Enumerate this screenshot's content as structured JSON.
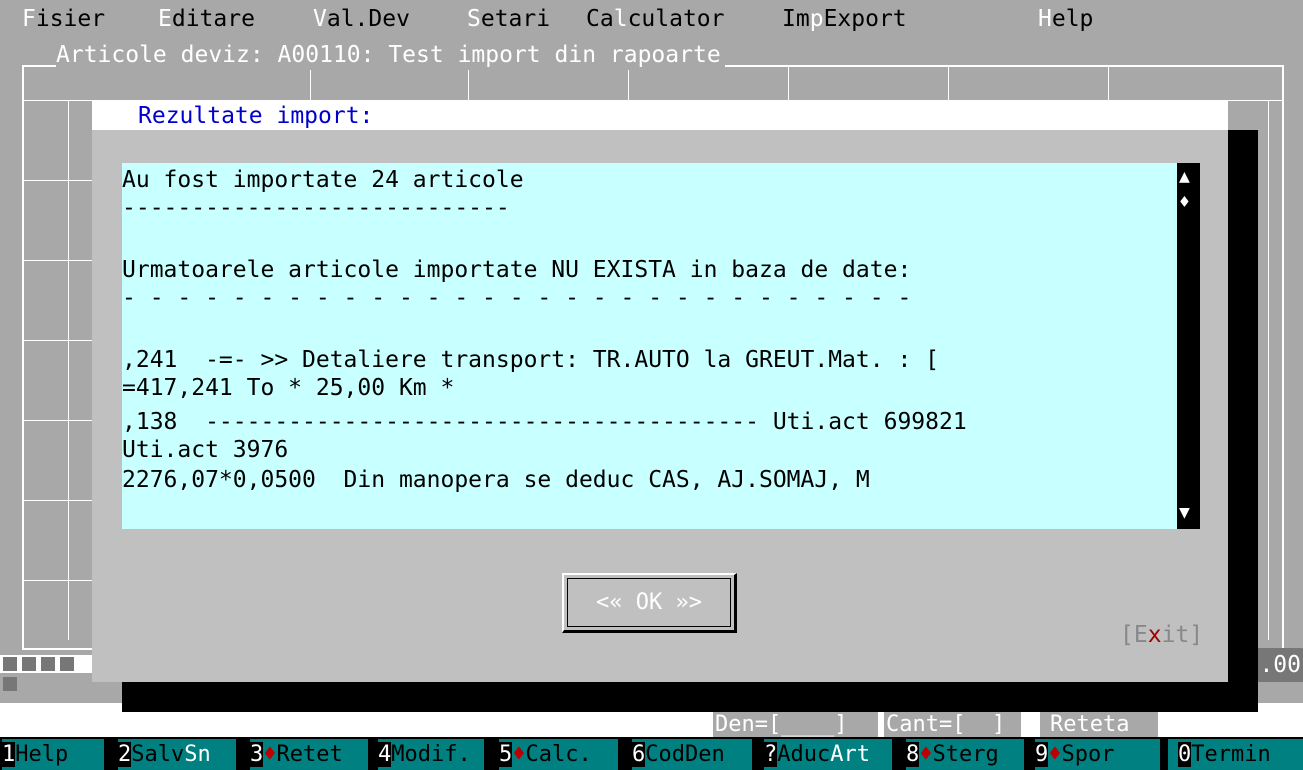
{
  "menu": [
    {
      "hotkey": "F",
      "rest": "isier"
    },
    {
      "hotkey": "E",
      "rest": "ditare"
    },
    {
      "hotkey": "V",
      "rest": "al.Dev"
    },
    {
      "hotkey": "S",
      "rest": "etari"
    },
    {
      "pre": "Ca",
      "hotkey": "l",
      "rest": "culator"
    },
    {
      "pre": "Im",
      "hotkey": "p",
      "rest": "Export"
    },
    {
      "hotkey": "H",
      "rest": "elp"
    }
  ],
  "window_title": "Articole deviz: A00110: Test import din rapoarte",
  "background_value": "0.00",
  "dialog": {
    "title": "Rezultate import:",
    "lines": [
      "Au fost importate 24 articole",
      "----------------------------",
      "",
      "Urmatoarele articole importate NU EXISTA in baza de date:",
      "- - - - - - - - - - - - - - - - - - - - - - - - - - - - -",
      "",
      ",241  -=- >> Detaliere transport: TR.AUTO la GREUT.Mat. : [",
      "=417,241 To * 25,00 Km *",
      ",138  ---------------------------------------- Uti.act 699821",
      "Uti.act 3976",
      "2276,07*0,0500  Din manopera se deduc CAS, AJ.SOMAJ, M"
    ],
    "ok_label": "<« OK »>",
    "exit_open": "[E",
    "exit_hotkey": "x",
    "exit_close": "it]"
  },
  "status": {
    "den": "Den=[____]",
    "cant": "Cant=[  ]",
    "reteta": "Reteta"
  },
  "function_keys": [
    {
      "num": "1",
      "label": "Help"
    },
    {
      "num": "2",
      "label": "Salv",
      "extra": "Sn"
    },
    {
      "num": "3",
      "diamond": "♦",
      "label": "Retet"
    },
    {
      "num": "4",
      "label": "Modif."
    },
    {
      "num": "5",
      "diamond": "♦",
      "label": "Calc."
    },
    {
      "num": "6",
      "label": "CodDen"
    },
    {
      "num": "?",
      "label": "Aduc",
      "extra": "Art"
    },
    {
      "num": "8",
      "diamond": "♦",
      "label": "Sterg"
    },
    {
      "num": "9",
      "diamond": "♦",
      "label": "Spor"
    },
    {
      "num": "0",
      "label": "Termin"
    }
  ]
}
